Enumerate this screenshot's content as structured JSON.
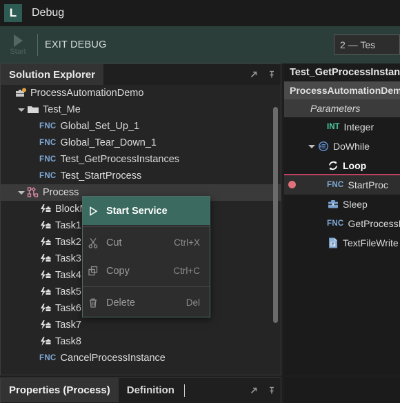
{
  "window": {
    "logo_letter": "L",
    "title": "Debug"
  },
  "toolbar": {
    "start_label": "Start",
    "exit_debug_label": "EXIT DEBUG",
    "process_select_value": "2 — Tes"
  },
  "solution_explorer": {
    "tab_label": "Solution Explorer",
    "float_icon": "float-arrow-icon",
    "pin_icon": "pin-icon",
    "tree": [
      {
        "label": "ProcessAutomationDemo",
        "icon": "project-briefcase-icon",
        "indent": 0,
        "twisty": false,
        "tag": "",
        "selected": false
      },
      {
        "label": "Test_Me",
        "icon": "folder-icon",
        "indent": 1,
        "twisty": true,
        "tag": "",
        "selected": false
      },
      {
        "label": "Global_Set_Up_1",
        "icon": "",
        "indent": 2,
        "twisty": false,
        "tag": "FNC",
        "selected": false
      },
      {
        "label": "Global_Tear_Down_1",
        "icon": "",
        "indent": 2,
        "twisty": false,
        "tag": "FNC",
        "selected": false
      },
      {
        "label": "Test_GetProcessInstances",
        "icon": "",
        "indent": 2,
        "twisty": false,
        "tag": "FNC",
        "selected": false
      },
      {
        "label": "Test_StartProcess",
        "icon": "",
        "indent": 2,
        "twisty": false,
        "tag": "FNC",
        "selected": false
      },
      {
        "label": "Process",
        "icon": "process-graph-icon",
        "indent": 1,
        "twisty": true,
        "tag": "",
        "selected": true
      },
      {
        "label": "BlockM",
        "icon": "task-bolt-icon",
        "indent": 2,
        "twisty": false,
        "tag": "",
        "selected": false
      },
      {
        "label": "Task1",
        "icon": "task-bolt-icon",
        "indent": 2,
        "twisty": false,
        "tag": "",
        "selected": false
      },
      {
        "label": "Task2",
        "icon": "task-bolt-icon",
        "indent": 2,
        "twisty": false,
        "tag": "",
        "selected": false
      },
      {
        "label": "Task3",
        "icon": "task-bolt-icon",
        "indent": 2,
        "twisty": false,
        "tag": "",
        "selected": false
      },
      {
        "label": "Task4",
        "icon": "task-bolt-icon",
        "indent": 2,
        "twisty": false,
        "tag": "",
        "selected": false
      },
      {
        "label": "Task5",
        "icon": "task-bolt-icon",
        "indent": 2,
        "twisty": false,
        "tag": "",
        "selected": false
      },
      {
        "label": "Task6",
        "icon": "task-bolt-icon",
        "indent": 2,
        "twisty": false,
        "tag": "",
        "selected": false
      },
      {
        "label": "Task7",
        "icon": "task-bolt-icon",
        "indent": 2,
        "twisty": false,
        "tag": "",
        "selected": false
      },
      {
        "label": "Task8",
        "icon": "task-bolt-icon",
        "indent": 2,
        "twisty": false,
        "tag": "",
        "selected": false
      },
      {
        "label": "CancelProcessInstance",
        "icon": "",
        "indent": 2,
        "twisty": false,
        "tag": "FNC",
        "selected": false
      }
    ]
  },
  "context_menu": {
    "items": [
      {
        "label": "Start Service",
        "shortcut": "",
        "icon": "play-icon",
        "highlight": true
      },
      {
        "label": "Cut",
        "shortcut": "Ctrl+X",
        "icon": "scissors-icon",
        "highlight": false
      },
      {
        "label": "Copy",
        "shortcut": "Ctrl+C",
        "icon": "copy-icon",
        "highlight": false
      },
      {
        "label": "Delete",
        "shortcut": "Del",
        "icon": "trash-icon",
        "highlight": false
      }
    ]
  },
  "editor_panel": {
    "title": "Test_GetProcessInstan",
    "breadcrumb": "ProcessAutomationDem",
    "section_label": "Parameters",
    "rows": [
      {
        "label": "Integer",
        "tag": "INT",
        "icon": "",
        "indent": 3,
        "twisty": false,
        "bold": false,
        "selected": false,
        "breakpoint": false,
        "underline": false
      },
      {
        "label": "DoWhile",
        "tag": "",
        "icon": "dowhile-icon",
        "indent": 2,
        "twisty": true,
        "bold": false,
        "selected": false,
        "breakpoint": false,
        "underline": false
      },
      {
        "label": "Loop",
        "tag": "",
        "icon": "loop-icon",
        "indent": 3,
        "twisty": false,
        "bold": true,
        "selected": false,
        "breakpoint": false,
        "underline": true
      },
      {
        "label": "StartProc",
        "tag": "FNC",
        "icon": "",
        "indent": 3,
        "twisty": false,
        "bold": false,
        "selected": true,
        "breakpoint": true,
        "underline": false
      },
      {
        "label": "Sleep",
        "tag": "",
        "icon": "sleep-toolbox-icon",
        "indent": 3,
        "twisty": false,
        "bold": false,
        "selected": false,
        "breakpoint": false,
        "underline": false
      },
      {
        "label": "GetProcessIn",
        "tag": "FNC",
        "icon": "",
        "indent": 3,
        "twisty": false,
        "bold": false,
        "selected": false,
        "breakpoint": false,
        "underline": false
      },
      {
        "label": "TextFileWrite",
        "tag": "",
        "icon": "textfile-icon",
        "indent": 3,
        "twisty": false,
        "bold": false,
        "selected": false,
        "breakpoint": false,
        "underline": false
      }
    ]
  },
  "bottom_tabs": {
    "items": [
      {
        "label": "Properties (Process)",
        "active": true
      },
      {
        "label": "Definition",
        "active": false
      }
    ],
    "float_icon": "float-arrow-icon",
    "pin_icon": "pin-icon"
  },
  "colors": {
    "accent_green": "#3b6a60",
    "toolbar_green": "#2b3e39",
    "fnc_blue": "#7fa8d4",
    "int_green": "#4ec9a0",
    "breakpoint_red": "#e2707a",
    "process_pink": "#d98aa8"
  }
}
